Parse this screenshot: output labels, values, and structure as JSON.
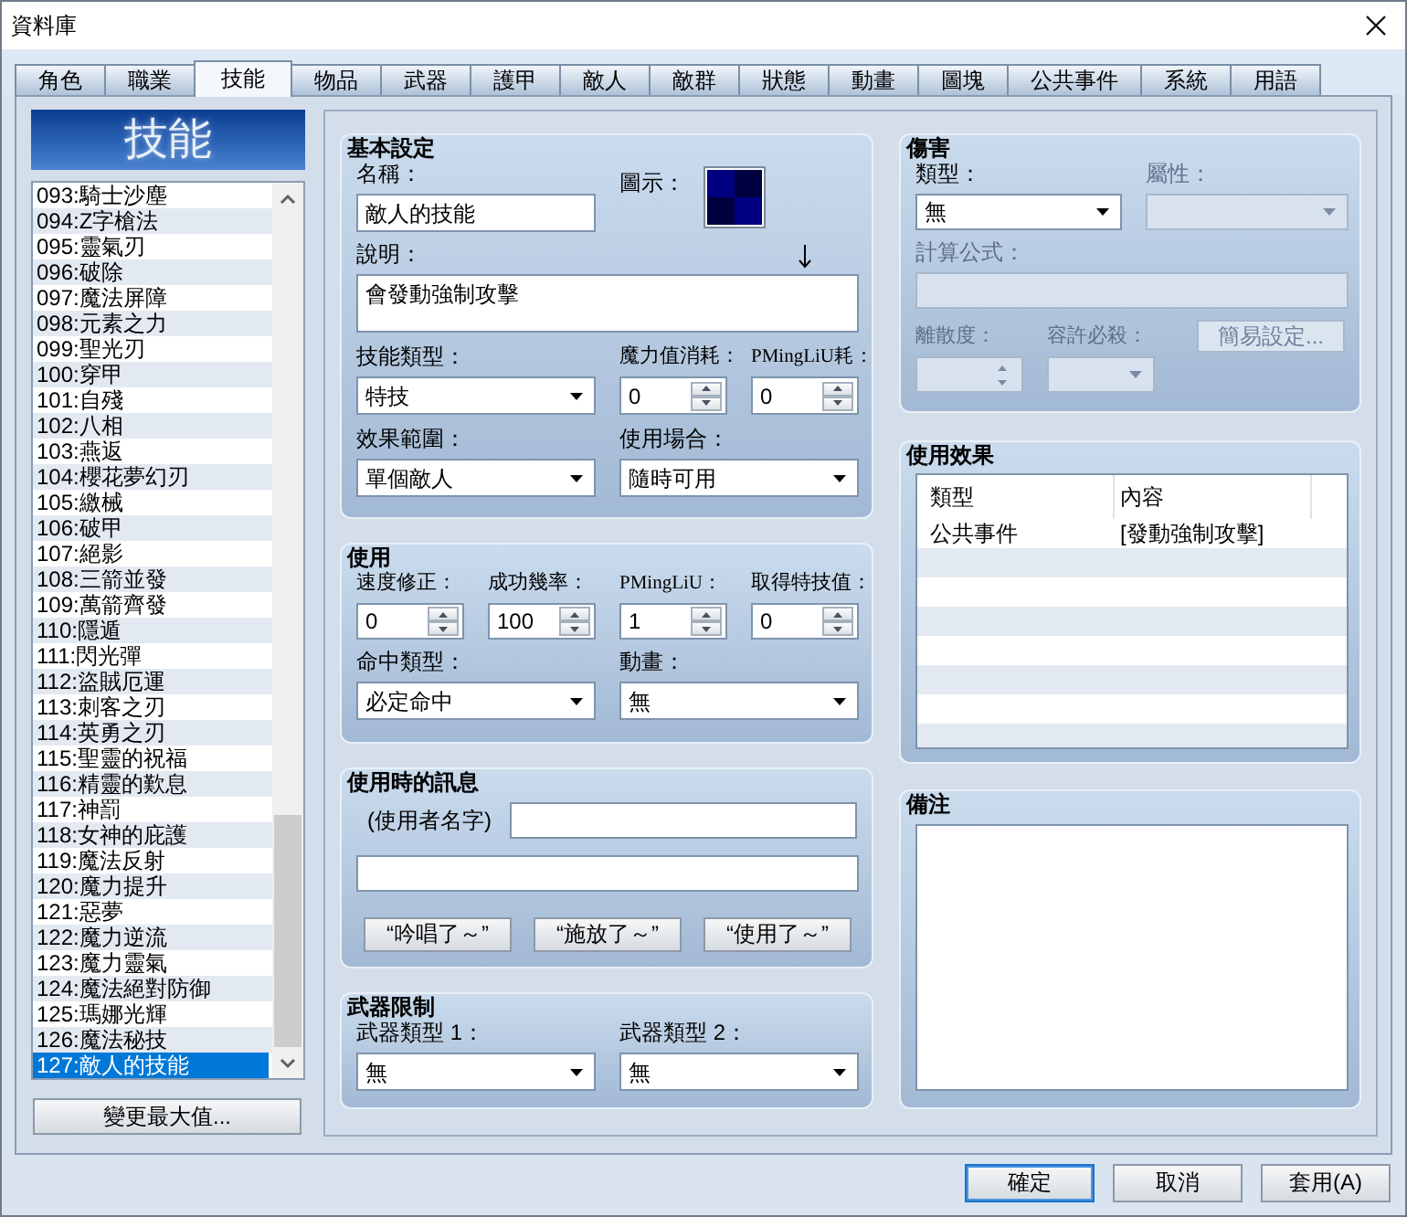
{
  "window": {
    "title": "資料庫"
  },
  "tabs": [
    {
      "label": "角色",
      "selected": false
    },
    {
      "label": "職業",
      "selected": false
    },
    {
      "label": "技能",
      "selected": true
    },
    {
      "label": "物品",
      "selected": false
    },
    {
      "label": "武器",
      "selected": false
    },
    {
      "label": "護甲",
      "selected": false
    },
    {
      "label": "敵人",
      "selected": false
    },
    {
      "label": "敵群",
      "selected": false
    },
    {
      "label": "狀態",
      "selected": false
    },
    {
      "label": "動畫",
      "selected": false
    },
    {
      "label": "圖塊",
      "selected": false
    },
    {
      "label": "公共事件",
      "selected": false
    },
    {
      "label": "系統",
      "selected": false
    },
    {
      "label": "用語",
      "selected": false
    }
  ],
  "skills": {
    "header": "技能",
    "items": [
      {
        "label": "093:騎士沙塵",
        "selected": false
      },
      {
        "label": "094:Z字槍法",
        "selected": false
      },
      {
        "label": "095:靈氣刃",
        "selected": false
      },
      {
        "label": "096:破除",
        "selected": false
      },
      {
        "label": "097:魔法屏障",
        "selected": false
      },
      {
        "label": "098:元素之力",
        "selected": false
      },
      {
        "label": "099:聖光刃",
        "selected": false
      },
      {
        "label": "100:穿甲",
        "selected": false
      },
      {
        "label": "101:自殘",
        "selected": false
      },
      {
        "label": "102:八相",
        "selected": false
      },
      {
        "label": "103:燕返",
        "selected": false
      },
      {
        "label": "104:櫻花夢幻刃",
        "selected": false
      },
      {
        "label": "105:繳械",
        "selected": false
      },
      {
        "label": "106:破甲",
        "selected": false
      },
      {
        "label": "107:絕影",
        "selected": false
      },
      {
        "label": "108:三箭並發",
        "selected": false
      },
      {
        "label": "109:萬箭齊發",
        "selected": false
      },
      {
        "label": "110:隱遁",
        "selected": false
      },
      {
        "label": "111:閃光彈",
        "selected": false
      },
      {
        "label": "112:盜賊厄運",
        "selected": false
      },
      {
        "label": "113:刺客之刃",
        "selected": false
      },
      {
        "label": "114:英勇之刃",
        "selected": false
      },
      {
        "label": "115:聖靈的祝福",
        "selected": false
      },
      {
        "label": "116:精靈的歎息",
        "selected": false
      },
      {
        "label": "117:神罰",
        "selected": false
      },
      {
        "label": "118:女神的庇護",
        "selected": false
      },
      {
        "label": "119:魔法反射",
        "selected": false
      },
      {
        "label": "120:魔力提升",
        "selected": false
      },
      {
        "label": "121:惡夢",
        "selected": false
      },
      {
        "label": "122:魔力逆流",
        "selected": false
      },
      {
        "label": "123:魔力靈氣",
        "selected": false
      },
      {
        "label": "124:魔法絕對防御",
        "selected": false
      },
      {
        "label": "125:瑪娜光輝",
        "selected": false
      },
      {
        "label": "126:魔法秘技",
        "selected": false
      },
      {
        "label": "127:敵人的技能",
        "selected": true
      }
    ],
    "max_button": "變更最大值..."
  },
  "basic_settings": {
    "title": "基本設定",
    "name": {
      "label": "名稱：",
      "value": "敵人的技能"
    },
    "icon": {
      "label": "圖示："
    },
    "description": {
      "label": "說明：",
      "value": "會發動強制攻擊"
    },
    "skill_type": {
      "label": "技能類型：",
      "value": "特技"
    },
    "mp_cost": {
      "label": "魔力值消耗：",
      "value": "0"
    },
    "cost_2": {
      "label": "PMingLiU耗：",
      "value": "0"
    },
    "scope": {
      "label": "效果範圍：",
      "value": "單個敵人"
    },
    "occasion": {
      "label": "使用場合：",
      "value": "隨時可用"
    }
  },
  "usage": {
    "title": "使用",
    "speed": {
      "label": "速度修正：",
      "value": "0"
    },
    "success_rate": {
      "label": "成功幾率：",
      "value": "100"
    },
    "field_3": {
      "label": "PMingLiU：",
      "value": "1"
    },
    "skill_points": {
      "label": "取得特技值：",
      "value": "0"
    },
    "hit_type": {
      "label": "命中類型：",
      "value": "必定命中"
    },
    "animation": {
      "label": "動畫：",
      "value": "無"
    }
  },
  "use_message": {
    "title": "使用時的訊息",
    "user_label": "(使用者名字)",
    "buttons": [
      "“吟唱了～”",
      "“施放了～”",
      "“使用了～”"
    ]
  },
  "weapon_limit": {
    "title": "武器限制",
    "weapon_type_1": {
      "label": "武器類型 1：",
      "value": "無"
    },
    "weapon_type_2": {
      "label": "武器類型 2：",
      "value": "無"
    }
  },
  "damage": {
    "title": "傷害",
    "type": {
      "label": "類型：",
      "value": "無",
      "disabled": false
    },
    "element": {
      "label": "屬性：",
      "disabled": true
    },
    "formula": {
      "label": "計算公式：",
      "disabled": true
    },
    "variance": {
      "label": "離散度：",
      "disabled": true
    },
    "critical": {
      "label": "容許必殺：",
      "disabled": true
    },
    "easy_setup": {
      "label": "簡易設定...",
      "disabled": true
    }
  },
  "effects": {
    "title": "使用效果",
    "columns": [
      "類型",
      "內容"
    ],
    "rows": [
      [
        "公共事件",
        "[發動強制攻擊]"
      ]
    ]
  },
  "notes": {
    "title": "備注"
  },
  "footer": {
    "buttons": [
      {
        "label": "確定",
        "default": true
      },
      {
        "label": "取消",
        "default": false
      },
      {
        "label": "套用(A)",
        "default": false
      }
    ]
  }
}
